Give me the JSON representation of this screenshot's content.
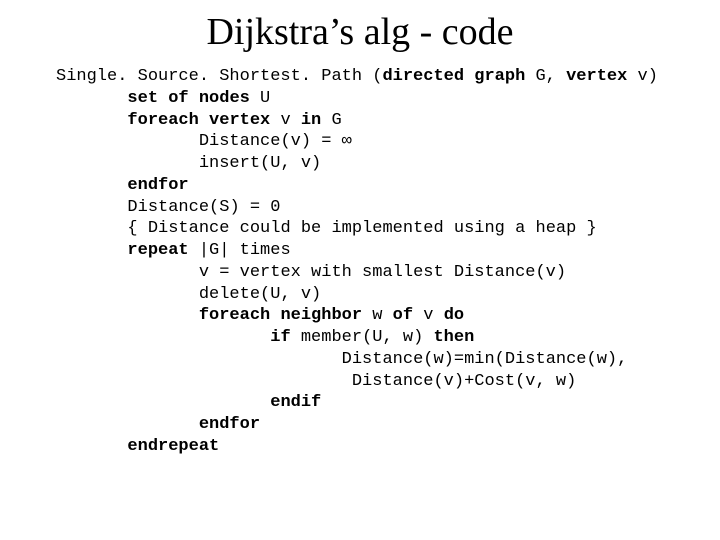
{
  "title": "Dijkstra’s alg - code",
  "code": {
    "l1a": "Single. Source. Shortest. Path (",
    "l1b": "directed graph",
    "l1c": " G, ",
    "l1d": "vertex",
    "l1e": " v)",
    "l2a": "set of nodes",
    "l2b": " U",
    "l3a": "foreach vertex ",
    "l3b": "v ",
    "l3c": "in ",
    "l3d": "G",
    "l4": "Distance(v) = ∞",
    "l5": "insert(U, v)",
    "l6": "endfor",
    "l7": "Distance(S) = 0",
    "l8": "{ Distance could be implemented using a heap }",
    "l9a": "repeat ",
    "l9b": "|G| times",
    "l10": "v = vertex with smallest Distance(v)",
    "l11": "delete(U, v)",
    "l12a": "foreach neighbor ",
    "l12b": "w ",
    "l12c": "of ",
    "l12d": "v ",
    "l12e": "do",
    "l13a": "if ",
    "l13b": "member(U, w) ",
    "l13c": "then",
    "l14": "Distance(w)=min(Distance(w),",
    "l15": "Distance(v)+Cost(v, w)",
    "l16": "endif",
    "l17": "endfor",
    "l18": "endrepeat"
  },
  "indent": {
    "i0": "",
    "i1": "       ",
    "i2": "              ",
    "i3": "                     ",
    "i4": "                            ",
    "i4b": "                             "
  }
}
